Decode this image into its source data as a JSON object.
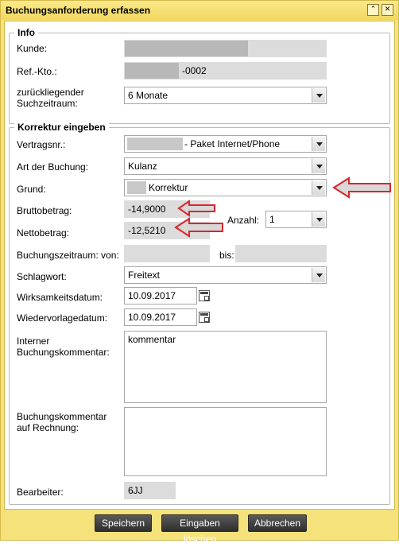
{
  "window": {
    "title": "Buchungsanforderung erfassen"
  },
  "icons": {
    "minimize": "collapse-icon",
    "close": "close-icon",
    "calendar": "calendar-icon",
    "dropdown": "chevron-down-icon"
  },
  "info": {
    "legend": "Info",
    "kunde_label": "Kunde:",
    "refkto_label": "Ref.-Kto.:",
    "refkto_value": "-0002",
    "zeitraum_label_1": "zurückliegender",
    "zeitraum_label_2": "Suchzeitraum:",
    "zeitraum_value": "6 Monate"
  },
  "korrektur": {
    "legend": "Korrektur eingeben",
    "vertragsnr_label": "Vertragsnr.:",
    "vertragsnr_value": "- Paket Internet/Phone",
    "art_label": "Art der Buchung:",
    "art_value": "Kulanz",
    "grund_label": "Grund:",
    "grund_value": "Korrektur",
    "brutto_label": "Bruttobetrag:",
    "brutto_value": "-14,9000",
    "netto_label": "Nettobetrag:",
    "netto_value": "-12,5210",
    "anzahl_label": "Anzahl:",
    "anzahl_value": "1",
    "zeitraum_von_label": "Buchungszeitraum: von:",
    "zeitraum_bis_label": "bis:",
    "schlagwort_label": "Schlagwort:",
    "schlagwort_value": "Freitext",
    "wirksam_label": "Wirksamkeitsdatum:",
    "wirksam_value": "10.09.2017",
    "wiedervorlage_label": "Wiedervorlagedatum:",
    "wiedervorlage_value": "10.09.2017",
    "intern_label_1": "Interner",
    "intern_label_2": "Buchungskommentar:",
    "intern_value": "kommentar",
    "rechnung_label_1": "Buchungskommentar",
    "rechnung_label_2": "auf Rechnung:",
    "rechnung_value": "",
    "bearbeiter_label": "Bearbeiter:",
    "bearbeiter_value": "6JJ"
  },
  "buttons": {
    "save": "Speichern",
    "clear": "Eingaben löschen",
    "cancel": "Abbrechen"
  },
  "colors": {
    "window_bg": "#f5e27a",
    "annotation_arrow": "#d9262c",
    "readonly_bg": "#dcdcdc"
  }
}
